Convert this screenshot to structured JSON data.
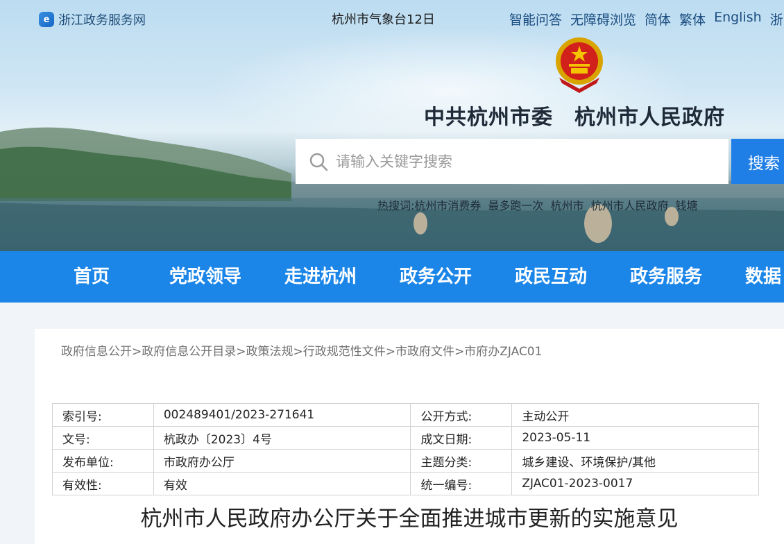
{
  "topbar": {
    "portal_name": "浙江政务服务网",
    "ticker_text": "杭州市气象台12日",
    "links": [
      "智能问答",
      "无障碍浏览",
      "简体",
      "繁体",
      "English",
      "浙"
    ]
  },
  "header": {
    "site_title": "中共杭州市委　杭州市人民政府"
  },
  "search": {
    "placeholder": "请输入关键字搜索",
    "button_label": "搜索",
    "hot_label": "热搜词:",
    "hot_words": [
      "杭州市消费券",
      "最多跑一次",
      "杭州市",
      "杭州市人民政府",
      "钱塘"
    ]
  },
  "nav": {
    "items": [
      "首页",
      "党政领导",
      "走进杭州",
      "政务公开",
      "政民互动",
      "政务服务",
      "数据"
    ]
  },
  "breadcrumb": [
    "政府信息公开",
    "政府信息公开目录",
    "政策法规",
    "行政规范性文件",
    "市政府文件",
    "市府办ZJAC01"
  ],
  "meta_table": {
    "rows": [
      [
        "索引号:",
        "002489401/2023-271641",
        "公开方式:",
        "主动公开"
      ],
      [
        "文号:",
        "杭政办〔2023〕4号",
        "成文日期:",
        "2023-05-11"
      ],
      [
        "发布单位:",
        "市政府办公厅",
        "主题分类:",
        "城乡建设、环境保护/其他"
      ],
      [
        "有效性:",
        "有效",
        "统一编号:",
        "ZJAC01-2023-0017"
      ]
    ]
  },
  "document": {
    "title": "杭州市人民政府办公厅关于全面推进城市更新的实施意见"
  },
  "colors": {
    "nav_blue": "#1b86e8",
    "search_button": "#1f7fe6",
    "link_blue": "#1a4c80"
  }
}
